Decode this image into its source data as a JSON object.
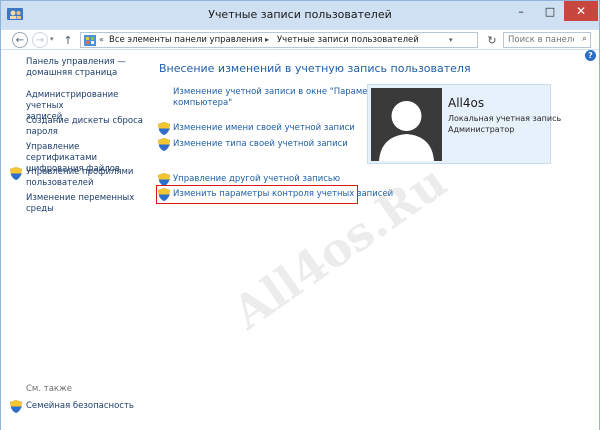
{
  "window": {
    "title": "Учетные записи пользователей"
  },
  "address": {
    "breadcrumbs": [
      "Все элементы панели управления",
      "Учетные записи пользователей"
    ],
    "overflow": "«"
  },
  "search": {
    "placeholder": "Поиск в панеле..."
  },
  "sidebar": {
    "items": [
      {
        "lines": [
          "Панель управления —",
          "домашняя страница"
        ],
        "shield": false
      },
      {
        "lines": [
          "Администрирование учетных",
          "записей"
        ],
        "shield": false
      },
      {
        "lines": [
          "Создание дискеты сброса",
          "пароля"
        ],
        "shield": false
      },
      {
        "lines": [
          "Управление сертификатами",
          "шифрования файлов"
        ],
        "shield": false
      },
      {
        "lines": [
          "Управление профилями",
          "пользователей"
        ],
        "shield": true
      },
      {
        "lines": [
          "Изменение переменных",
          "среды"
        ],
        "shield": false
      }
    ],
    "see_also": "См. также",
    "family_safety": "Семейная безопасность"
  },
  "main": {
    "heading": "Внесение изменений в учетную запись пользователя",
    "tasks": [
      {
        "lines": [
          "Изменение учетной записи в окне \"Параметры",
          "компьютера\""
        ],
        "shield": false
      },
      {
        "lines": [
          "Изменение имени своей учетной записи"
        ],
        "shield": true
      },
      {
        "lines": [
          "Изменение типа своей учетной записи"
        ],
        "shield": true
      },
      {
        "lines": [
          "Управление другой учетной записью"
        ],
        "shield": true
      },
      {
        "lines": [
          "Изменить параметры контроля учетных записей"
        ],
        "shield": true
      }
    ]
  },
  "user": {
    "name": "All4os",
    "account_type": "Локальная учетная запись",
    "role": "Администратор"
  },
  "watermark": "All4os.Ru",
  "colors": {
    "link": "#1e5fa6",
    "heading": "#1f5ea8",
    "titlebar": "#cfe0f3",
    "close": "#c7463d",
    "highlight": "#d21a1a",
    "tile": "#e6f1fb"
  }
}
